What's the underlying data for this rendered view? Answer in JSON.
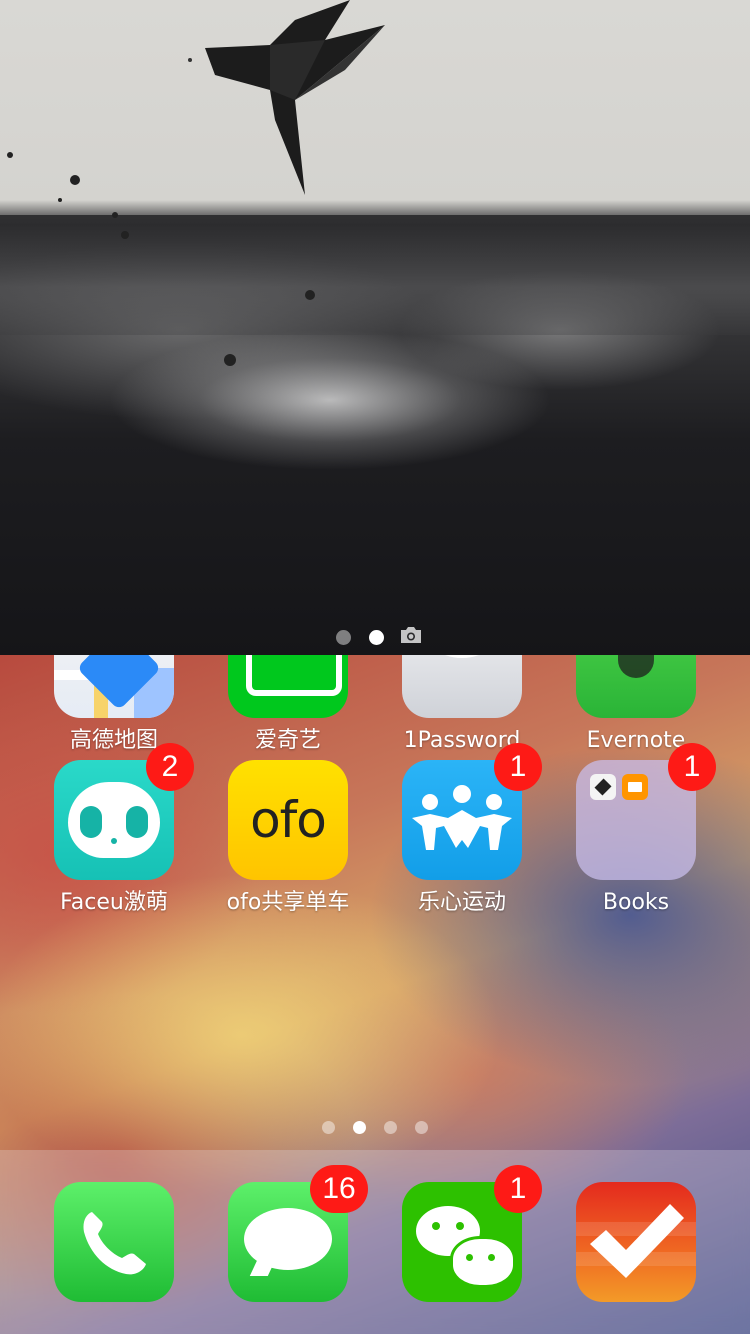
{
  "lock_screen": {
    "page_dots": 2,
    "active_page": 1,
    "camera_icon": "camera-icon"
  },
  "home": {
    "top_row": [
      {
        "label": "高德地图",
        "icon": "map-icon"
      },
      {
        "label": "爱奇艺",
        "icon": "iqiyi-icon"
      },
      {
        "label": "1Password",
        "icon": "keyhole-icon"
      },
      {
        "label": "Evernote",
        "icon": "elephant-icon"
      }
    ],
    "second_row": [
      {
        "label": "Faceu激萌",
        "icon": "faceu-icon",
        "badge": "2"
      },
      {
        "label": "ofo共享单车",
        "icon": "ofo-icon",
        "icon_text": "ofo"
      },
      {
        "label": "乐心运动",
        "icon": "people-icon",
        "badge": "1"
      },
      {
        "label": "Books",
        "icon": "folder-icon",
        "badge": "1"
      }
    ],
    "page_dots": 4,
    "active_page": 1
  },
  "dock": [
    {
      "name": "phone",
      "icon": "phone-icon"
    },
    {
      "name": "messages",
      "icon": "message-bubble-icon",
      "badge": "16"
    },
    {
      "name": "wechat",
      "icon": "wechat-icon",
      "badge": "1"
    },
    {
      "name": "todoist",
      "icon": "checkmark-icon"
    }
  ],
  "colors": {
    "badge": "#fe1a16",
    "faceu": "#23d3c4",
    "ofo": "#ffd400",
    "lexin": "#1eaaf1",
    "phone": "#3ccf44",
    "messages": "#3ccf44",
    "wechat": "#2dc100",
    "todoist": "#e8401e"
  }
}
